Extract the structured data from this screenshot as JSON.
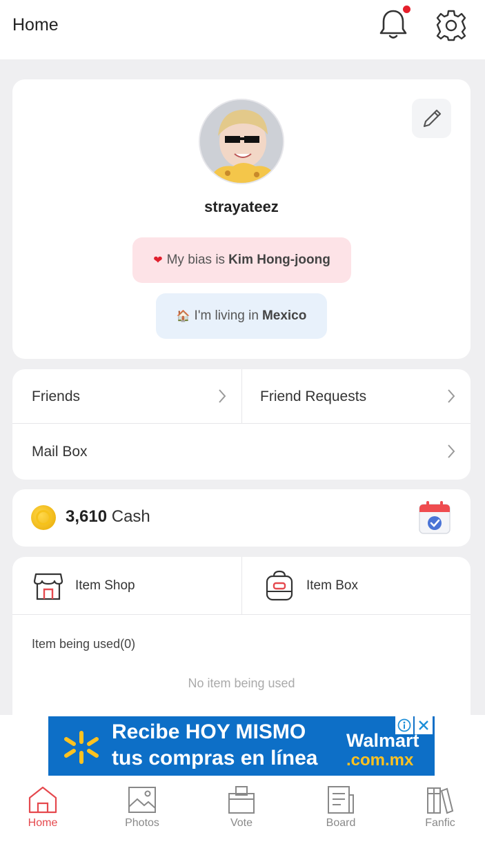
{
  "header": {
    "title": "Home",
    "notification_dot_color": "#e51f2b"
  },
  "profile": {
    "username": "strayateez",
    "bias_prefix": "My bias is",
    "bias_name": "Kim Hong-joong",
    "living_prefix": "I'm living in",
    "living_place": "Mexico"
  },
  "menu": {
    "friends": "Friends",
    "friend_requests": "Friend Requests",
    "mail_box": "Mail Box"
  },
  "cash": {
    "amount": "3,610",
    "unit": "Cash"
  },
  "items": {
    "shop_label": "Item Shop",
    "box_label": "Item Box",
    "used_title": "Item being used(0)",
    "empty_note": "No item being used"
  },
  "ad": {
    "line1": "Recibe HOY MISMO",
    "line2": "tus compras en línea",
    "brand": "Walmart",
    "domain": ".com.mx"
  },
  "tabs": [
    {
      "label": "Home",
      "active": true
    },
    {
      "label": "Photos",
      "active": false
    },
    {
      "label": "Vote",
      "active": false
    },
    {
      "label": "Board",
      "active": false
    },
    {
      "label": "Fanfic",
      "active": false
    }
  ],
  "colors": {
    "accent": "#e5484d",
    "bias_pill": "#fde3e7",
    "living_pill": "#e8f1fb",
    "ad_background": "#0d6fc7"
  }
}
